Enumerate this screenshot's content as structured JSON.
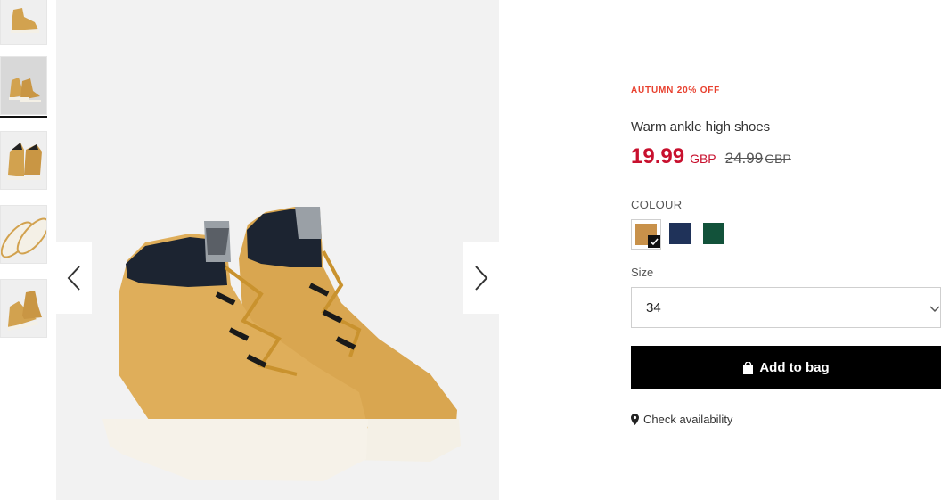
{
  "thumbnails": [
    {
      "alt": "boots-side-view"
    },
    {
      "alt": "boots-pair-front",
      "active": true
    },
    {
      "alt": "boots-back-view"
    },
    {
      "alt": "boots-sole-view"
    },
    {
      "alt": "boots-angle-view"
    }
  ],
  "product": {
    "promo": "AUTUMN 20% OFF",
    "title": "Warm ankle high shoes",
    "price_now": "19.99",
    "price_now_currency": "GBP",
    "price_old": "24.99",
    "price_old_currency": "GBP"
  },
  "colour": {
    "label": "COLOUR",
    "swatches": [
      {
        "name": "camel",
        "color": "#c8914a",
        "selected": true
      },
      {
        "name": "navy",
        "color": "#1f3259"
      },
      {
        "name": "green",
        "color": "#12523a"
      }
    ]
  },
  "size": {
    "label": "Size",
    "value": "34"
  },
  "actions": {
    "add_to_bag": "Add to bag",
    "check_availability": "Check availability"
  },
  "colors": {
    "promo": "#e8402e",
    "price": "#c8102e",
    "button_bg": "#000000"
  }
}
